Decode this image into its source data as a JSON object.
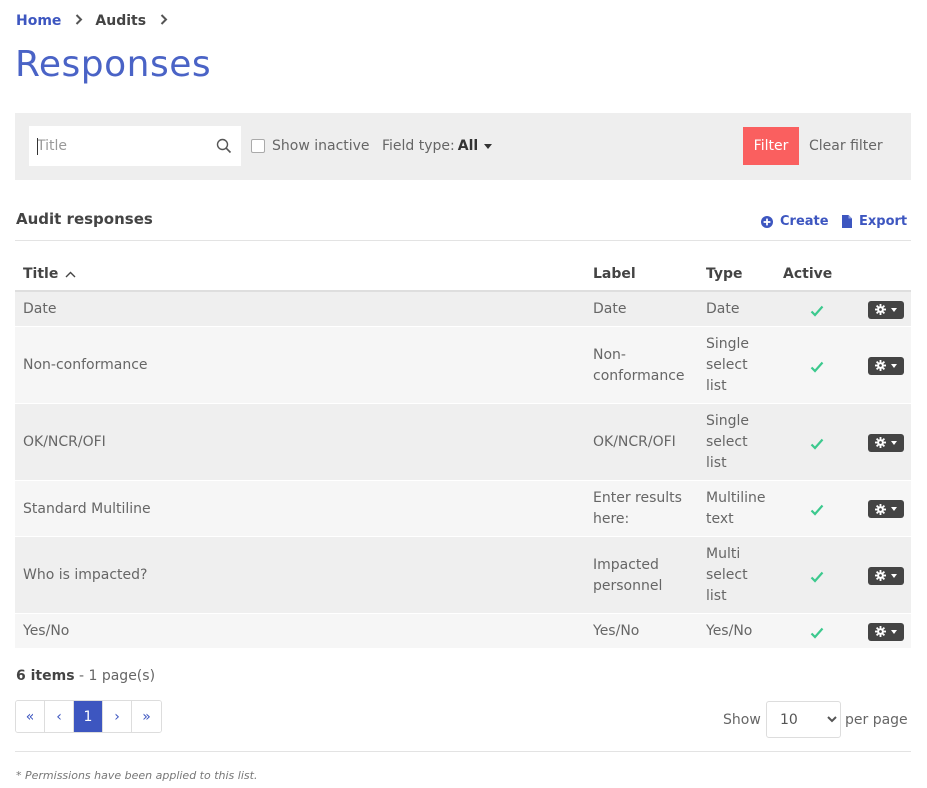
{
  "breadcrumb": {
    "items": [
      "Home",
      "Audits"
    ]
  },
  "page": {
    "title": "Responses"
  },
  "filter": {
    "search_placeholder": "Title",
    "show_inactive_label": "Show inactive",
    "field_type_label": "Field type:",
    "field_type_value": "All",
    "filter_button": "Filter",
    "clear_button": "Clear filter",
    "filter_color": "#fa5f5f"
  },
  "section": {
    "title": "Audit responses",
    "create_label": "Create",
    "export_label": "Export",
    "accent_color": "#3d56c0"
  },
  "table": {
    "columns": {
      "title": "Title",
      "label": "Label",
      "type": "Type",
      "active": "Active"
    },
    "sort": {
      "column": "Title",
      "direction": "ascending",
      "icon": "chevron-up-icon"
    },
    "rows": [
      {
        "title": "Date",
        "label": [
          "Date"
        ],
        "type": [
          "Date"
        ],
        "active": "check-icon"
      },
      {
        "title": "Non-conformance",
        "label": [
          "Non-",
          "conformance"
        ],
        "type": [
          "Single",
          "select",
          "list"
        ],
        "active": "check-icon"
      },
      {
        "title": "OK/NCR/OFI",
        "label": [
          "OK/NCR/OFI"
        ],
        "type": [
          "Single",
          "select",
          "list"
        ],
        "active": "check-icon"
      },
      {
        "title": "Standard Multiline",
        "label": [
          "Enter results",
          "here:"
        ],
        "type": [
          "Multiline",
          "text"
        ],
        "active": "check-icon"
      },
      {
        "title": "Who is impacted?",
        "label": [
          "Impacted",
          "personnel"
        ],
        "type": [
          "Multi",
          "select",
          "list"
        ],
        "active": "check-icon"
      },
      {
        "title": "Yes/No",
        "label": [
          "Yes/No"
        ],
        "type": [
          "Yes/No"
        ],
        "active": "check-icon"
      }
    ],
    "active_color": "#3cc98e"
  },
  "footer": {
    "items_count": "6 items",
    "pages_text": " - 1 page(s)",
    "pagination": {
      "first": "«",
      "prev": "‹",
      "current": "1",
      "next": "›",
      "last": "»"
    },
    "show_label": "Show",
    "per_page_value": "10",
    "per_page_options": [
      "10"
    ],
    "per_page_label": "per page",
    "note": "* Permissions have been applied to this list."
  }
}
